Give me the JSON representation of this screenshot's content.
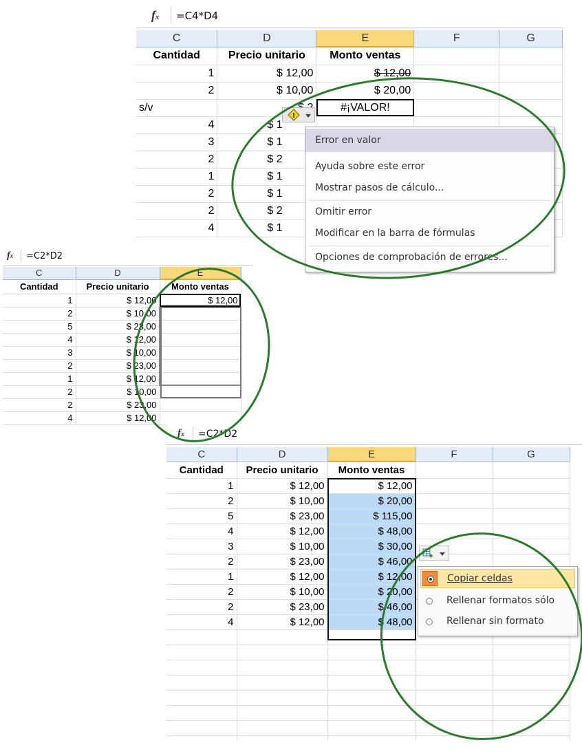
{
  "panel1": {
    "formula_icon": "fx-icon",
    "formula": "=C4*D4",
    "columns": [
      "C",
      "D",
      "E",
      "F",
      "G"
    ],
    "header": [
      "Cantidad",
      "Precio unitario",
      "Monto ventas"
    ],
    "rows": [
      {
        "c": "1",
        "d": "$ 12,00",
        "e": "$ 12,00"
      },
      {
        "c": "2",
        "d": "$ 10,00",
        "e": "$ 20,00"
      },
      {
        "c": "s/v",
        "d": "$ 2",
        "e": "#¡VALOR!"
      },
      {
        "c": "4",
        "d": "$ 1",
        "e": ""
      },
      {
        "c": "3",
        "d": "$ 1",
        "e": ""
      },
      {
        "c": "2",
        "d": "$ 2",
        "e": ""
      },
      {
        "c": "1",
        "d": "$ 1",
        "e": ""
      },
      {
        "c": "2",
        "d": "$ 1",
        "e": ""
      },
      {
        "c": "2",
        "d": "$ 2",
        "e": ""
      },
      {
        "c": "4",
        "d": "$ 1",
        "e": ""
      }
    ],
    "error_menu": [
      "Error en valor",
      "Ayuda sobre este error",
      "Mostrar pasos de cálculo...",
      "Omitir error",
      "Modificar en la barra de fórmulas",
      "Opciones de comprobación de errores..."
    ]
  },
  "panel2": {
    "formula_icon": "fx-icon",
    "formula": "=C2*D2",
    "columns": [
      "C",
      "D",
      "E"
    ],
    "header": [
      "Cantidad",
      "Precio unitario",
      "Monto ventas"
    ],
    "rows": [
      {
        "c": "1",
        "d": "$ 12,00",
        "e": "$ 12,00"
      },
      {
        "c": "2",
        "d": "$ 10,00",
        "e": ""
      },
      {
        "c": "5",
        "d": "$ 23,00",
        "e": ""
      },
      {
        "c": "4",
        "d": "$ 12,00",
        "e": ""
      },
      {
        "c": "3",
        "d": "$ 10,00",
        "e": ""
      },
      {
        "c": "2",
        "d": "$ 23,00",
        "e": ""
      },
      {
        "c": "1",
        "d": "$ 12,00",
        "e": ""
      },
      {
        "c": "2",
        "d": "$ 10,00",
        "e": ""
      },
      {
        "c": "2",
        "d": "$ 23,00",
        "e": ""
      },
      {
        "c": "4",
        "d": "$ 12,00",
        "e": ""
      }
    ]
  },
  "panel3": {
    "formula_icon": "fx-icon",
    "formula": "=C2*D2",
    "columns": [
      "C",
      "D",
      "E",
      "F",
      "G"
    ],
    "header": [
      "Cantidad",
      "Precio unitario",
      "Monto ventas"
    ],
    "rows": [
      {
        "c": "1",
        "d": "$ 12,00",
        "e": "$ 12,00"
      },
      {
        "c": "2",
        "d": "$ 10,00",
        "e": "$ 20,00"
      },
      {
        "c": "5",
        "d": "$ 23,00",
        "e": "$ 115,00"
      },
      {
        "c": "4",
        "d": "$ 12,00",
        "e": "$ 48,00"
      },
      {
        "c": "3",
        "d": "$ 10,00",
        "e": "$ 30,00"
      },
      {
        "c": "2",
        "d": "$ 23,00",
        "e": "$ 46,00"
      },
      {
        "c": "1",
        "d": "$ 12,00",
        "e": "$ 12,00"
      },
      {
        "c": "2",
        "d": "$ 10,00",
        "e": "$ 20,00"
      },
      {
        "c": "2",
        "d": "$ 23,00",
        "e": "$ 46,00"
      },
      {
        "c": "4",
        "d": "$ 12,00",
        "e": "$ 48,00"
      }
    ],
    "autofill_icon": "autofill-options-icon",
    "autofill_menu": [
      "Copiar celdas",
      "Rellenar formatos sólo",
      "Rellenar sin formato"
    ],
    "autofill_selected": "Copiar celdas"
  },
  "colors": {
    "annotation": "#2c7a2c",
    "selected_column_header": "#f9d77b",
    "fill_selection": "#bcd9f5",
    "error_icon": "#e8c21a"
  }
}
